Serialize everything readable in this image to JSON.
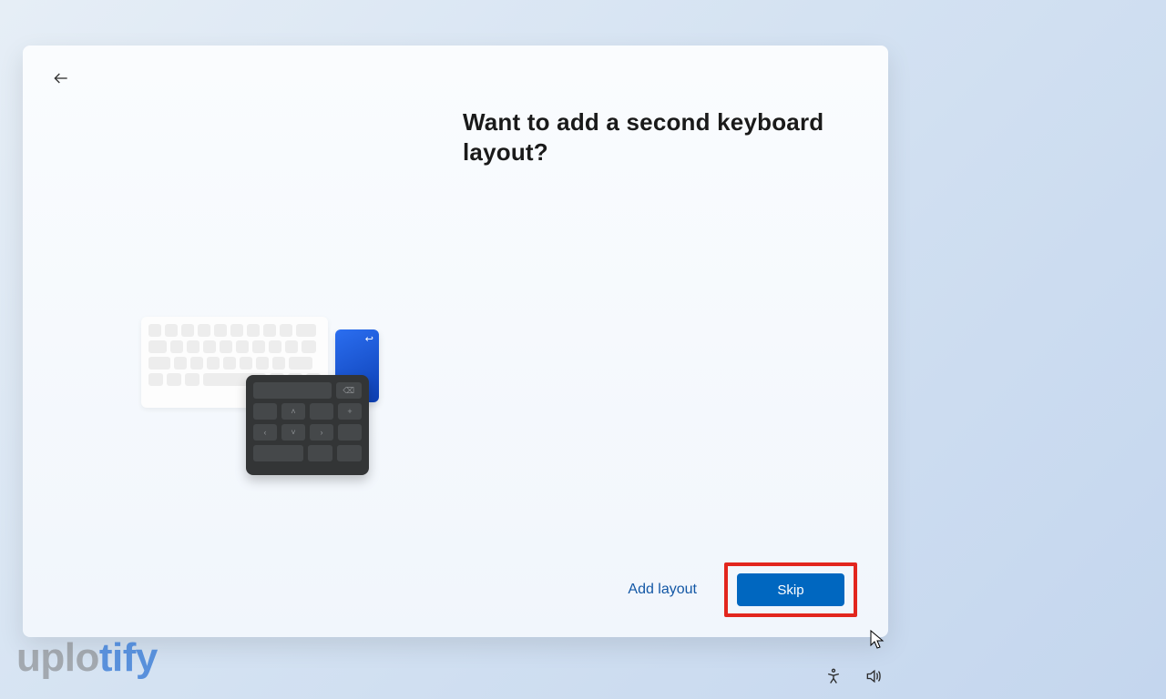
{
  "dialog": {
    "heading": "Want to add a second keyboard layout?",
    "add_layout_label": "Add layout",
    "skip_label": "Skip"
  },
  "watermark": {
    "part1": "uplo",
    "part2": "tify"
  }
}
